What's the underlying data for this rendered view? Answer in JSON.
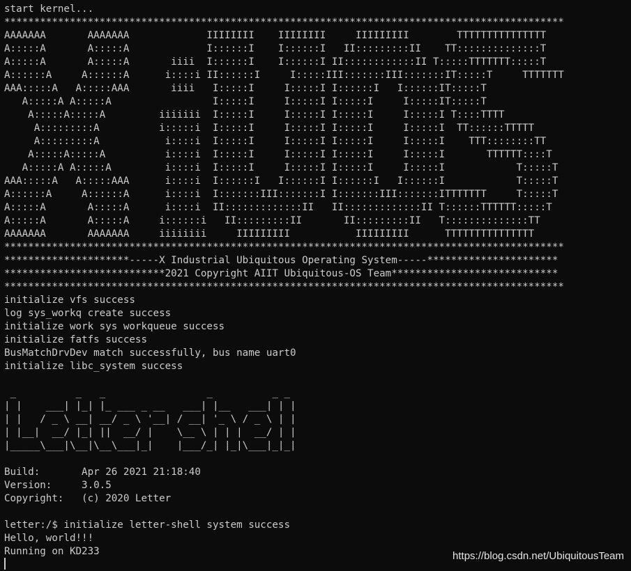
{
  "terminal": {
    "lines": [
      "start kernel...",
      "**********************************************************************************************",
      "AAAAAAA       AAAAAAA             IIIIIIII    IIIIIIII     IIIIIIIII        TTTTTTTTTTTTTTT",
      "A:::::A       A:::::A             I::::::I    I::::::I   II:::::::::II    TT::::::::::::::T",
      "A:::::A       A:::::A       iiii  I::::::I    I::::::I II::::::::::::II T:::::TTTTTTT:::::T",
      "A::::::A     A::::::A      i::::i II::::::I     I:::::III:::::::III:::::::IT:::::T     TTTTTTT",
      "AAA:::::A   A:::::AAA       iiii   I:::::I     I:::::I I::::::I   I::::::IT:::::T",
      "   A:::::A A:::::A                 I:::::I     I:::::I I:::::I     I:::::IT:::::T",
      "    A:::::A:::::A         iiiiiii  I:::::I     I:::::I I:::::I     I:::::I T::::TTTT",
      "     A:::::::::A          i:::::i  I:::::I     I:::::I I:::::I     I:::::I  TT::::::TTTTT",
      "     A:::::::::A           i::::i  I:::::I     I:::::I I:::::I     I:::::I    TTT::::::::TT",
      "    A:::::A:::::A          i::::i  I:::::I     I:::::I I:::::I     I:::::I       TTTTTT::::T",
      "   A:::::A A:::::A         i::::i  I:::::I     I:::::I I:::::I     I:::::I            T:::::T",
      "AAA:::::A   A:::::AAA      i::::i  I::::::I   I::::::I I::::::I   I::::::I            T:::::T",
      "A::::::A     A::::::A      i::::i  I:::::::III:::::::I I:::::::III:::::::ITTTTTTT     T:::::T",
      "A:::::A       A:::::A      i::::i  II:::::::::::::II   II:::::::::::::II T::::::TTTTTT:::::T",
      "A:::::A       A:::::A     i::::::i   II:::::::::II       II:::::::::II   T::::::::::::::TT",
      "AAAAAAA       AAAAAAA     iiiiiiii     IIIIIIIII           IIIIIIIII      TTTTTTTTTTTTTTT",
      "**********************************************************************************************",
      "*********************-----X Industrial Ubiquitous Operating System-----**********************",
      "***************************2021 Copyright AIIT Ubiquitous-OS Team****************************",
      "**********************************************************************************************",
      "initialize vfs success",
      "log sys_workq create success",
      "initialize work sys workqueue success",
      "initialize fatfs success",
      "BusMatchDrvDev match successfully, bus name uart0",
      "initialize libc_system success",
      "",
      " _          _   _                 _          _ _",
      "| |    ___| |_| |_ ___ _ __   ___| |__   ___| | |",
      "| |   / _ \\ __| __/ _ \\ '__| / __| '_ \\ / _ \\ | |",
      "| |__|  __/ |_| ||  __/ |    \\__ \\ | | |  __/ | |",
      "|_____\\___|\\__|\\__\\___|_|    |___/_| |_|\\___|_|_|",
      "",
      "Build:       Apr 26 2021 21:18:40",
      "Version:     3.0.5",
      "Copyright:   (c) 2020 Letter",
      "",
      "letter:/$ initialize letter-shell system success",
      "Hello, world!!!",
      "Running on KD233"
    ]
  },
  "watermark": "https://blog.csdn.net/UbiquitousTeam",
  "colors": {
    "background": "#0c0c0c",
    "foreground": "#cccccc"
  }
}
